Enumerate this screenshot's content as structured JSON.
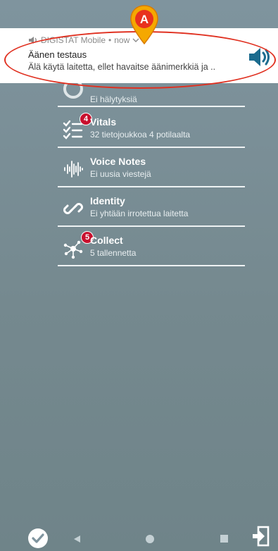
{
  "notification": {
    "app_name": "DIGISTAT Mobile",
    "time": "now",
    "title": "Äänen testaus",
    "body": "Älä käytä laitetta, ellet havaitse äänimerkkiä ja ..",
    "marker_label": "A"
  },
  "list": {
    "items": [
      {
        "title": "",
        "subtitle": "Ei hälytyksiä",
        "icon": "eye-icon"
      },
      {
        "title": "Vitals",
        "subtitle": "32 tietojoukkoa 4 potilaalta",
        "badge": "4",
        "icon": "checklist-icon"
      },
      {
        "title": "Voice Notes",
        "subtitle": "Ei uusia viestejä",
        "icon": "waveform-icon"
      },
      {
        "title": "Identity",
        "subtitle": "Ei yhtään irrotettua laitetta",
        "icon": "link-icon"
      },
      {
        "title": "Collect",
        "subtitle": "5 tallennetta",
        "badge": "5",
        "icon": "network-icon"
      }
    ]
  },
  "colors": {
    "background": "#7f949e",
    "badge": "#c8102e",
    "annotation": "#e03020",
    "marker": "#f5a800"
  }
}
